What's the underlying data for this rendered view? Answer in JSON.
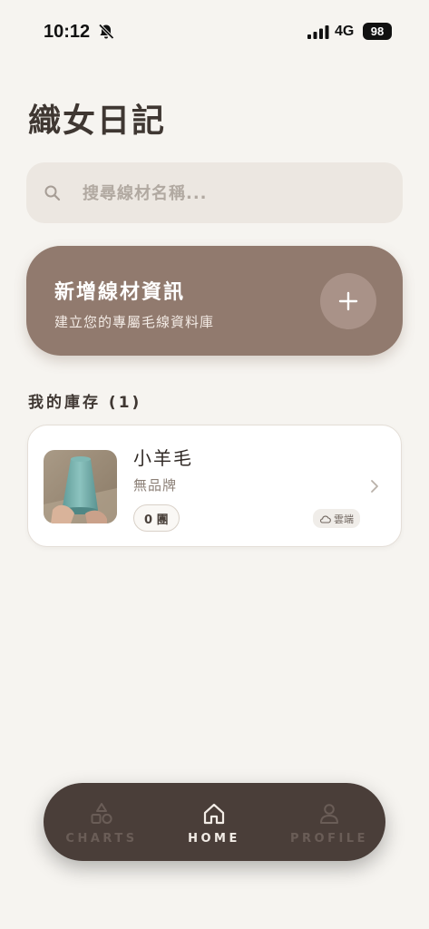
{
  "status_bar": {
    "time": "10:12",
    "network": "4G",
    "battery": "98"
  },
  "page": {
    "title": "織女日記"
  },
  "search": {
    "placeholder": "搜尋線材名稱..."
  },
  "add_card": {
    "title": "新增線材資訊",
    "subtitle": "建立您的專屬毛線資料庫"
  },
  "inventory": {
    "title": "我的庫存 (1)",
    "items": [
      {
        "name": "小羊毛",
        "brand": "無品牌",
        "count": "0 團",
        "sync": "雲端"
      }
    ]
  },
  "bottom_nav": {
    "items": [
      {
        "label": "CHARTS",
        "icon": "shapes-icon",
        "active": false
      },
      {
        "label": "HOME",
        "icon": "home-icon",
        "active": true
      },
      {
        "label": "PROFILE",
        "icon": "user-icon",
        "active": false
      }
    ]
  },
  "colors": {
    "background": "#f6f4f0",
    "accent_card": "#917a6e",
    "nav_background": "#4a3e39",
    "text_primary": "#3f3732"
  }
}
